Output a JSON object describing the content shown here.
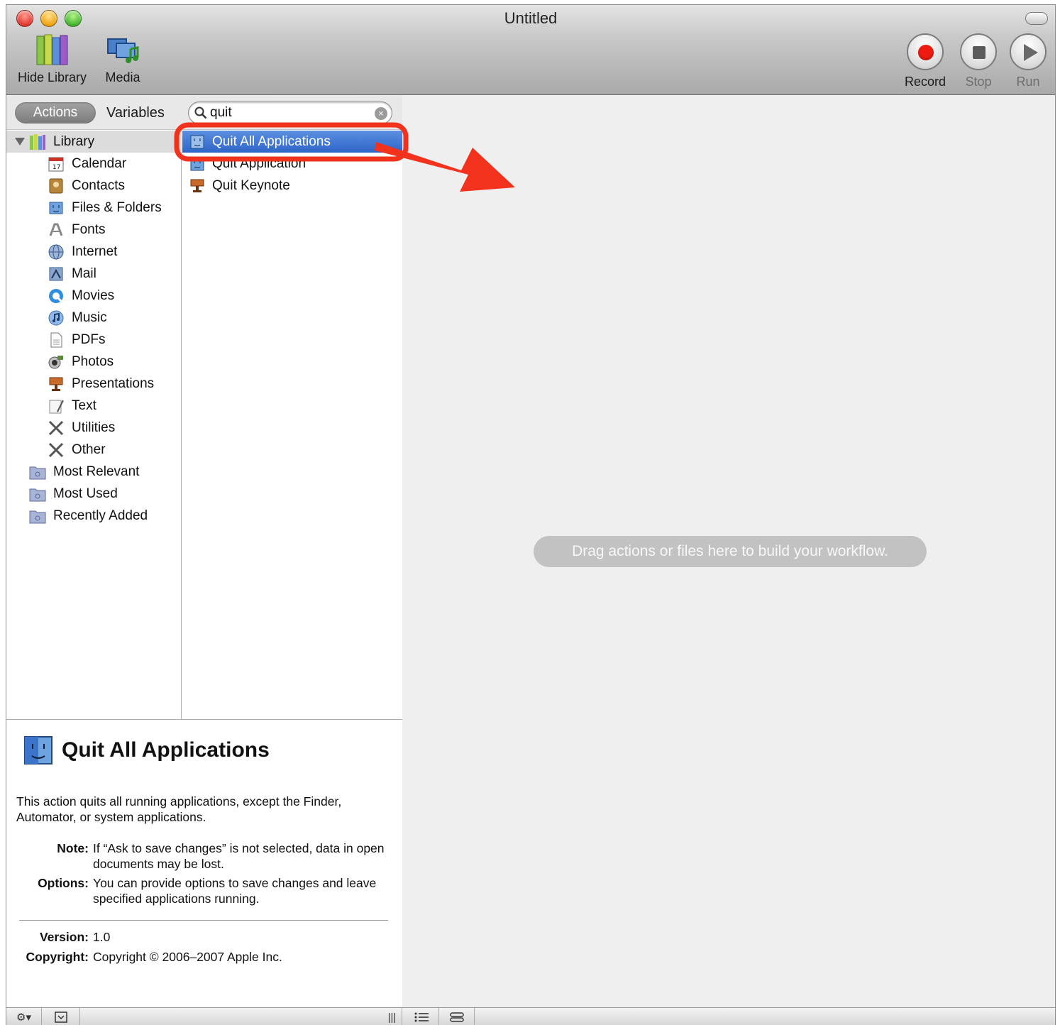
{
  "window": {
    "title": "Untitled"
  },
  "toolbar": {
    "hide_library_label": "Hide Library",
    "media_label": "Media",
    "record_label": "Record",
    "stop_label": "Stop",
    "run_label": "Run"
  },
  "library_header": {
    "actions_tab": "Actions",
    "variables_tab": "Variables",
    "search_value": "quit",
    "search_clear": "×"
  },
  "categories": {
    "library": "Library",
    "items": [
      "Calendar",
      "Contacts",
      "Files & Folders",
      "Fonts",
      "Internet",
      "Mail",
      "Movies",
      "Music",
      "PDFs",
      "Photos",
      "Presentations",
      "Text",
      "Utilities",
      "Other"
    ],
    "smart_groups": [
      "Most Relevant",
      "Most Used",
      "Recently Added"
    ]
  },
  "actions": {
    "items": [
      "Quit All Applications",
      "Quit Application",
      "Quit Keynote"
    ],
    "selected_index": 0
  },
  "description": {
    "title": "Quit All Applications",
    "body": "This action quits all running applications, except the Finder, Automator, or system applications.",
    "note_label": "Note:",
    "note_text": "If “Ask to save changes” is not selected, data in open documents may be lost.",
    "options_label": "Options:",
    "options_text": "You can provide options to save changes and leave specified applications running.",
    "version_label": "Version:",
    "version_value": "1.0",
    "copyright_label": "Copyright:",
    "copyright_value": "Copyright © 2006–2007 Apple Inc."
  },
  "workflow": {
    "hint": "Drag actions or files here to build your workflow."
  },
  "bottombar": {
    "gear": "⚙▾",
    "resize_grip": "|||"
  },
  "colors": {
    "selection": "#2f65c9",
    "annotation_red": "#f2321c",
    "record_red": "#ee1c10"
  }
}
